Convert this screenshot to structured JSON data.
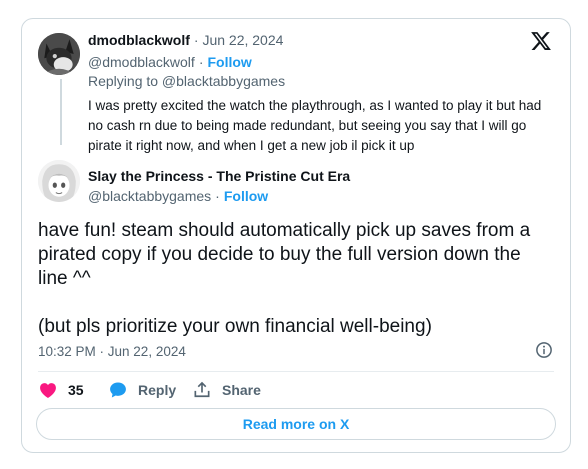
{
  "reply_tweet": {
    "display_name": "dmodblackwolf",
    "date": "· Jun 22, 2024",
    "handle": "@dmodblackwolf",
    "follow_label": "Follow",
    "dot": "·",
    "replying_to": "Replying to @blacktabbygames",
    "text": "I was pretty excited the watch the playthrough, as I wanted to play it but had no cash rn due to being made redundant, but seeing you say that I will go pirate it right now, and when I get a new job il pick it up"
  },
  "main_tweet": {
    "display_name": "Slay the Princess - The Pristine Cut Era",
    "handle": "@blacktabbygames",
    "follow_label": "Follow",
    "dot": "·",
    "text": "have fun! steam should automatically pick up saves from a pirated copy if you decide to buy the full version down the line ^^\n\n(but pls prioritize your own financial well-being)",
    "timestamp": "10:32 PM · Jun 22, 2024"
  },
  "actions": {
    "like_count": "35",
    "reply_label": "Reply",
    "share_label": "Share"
  },
  "read_more_label": "Read more on X",
  "colors": {
    "accent": "#1d9bf0",
    "like": "#f91880",
    "muted": "#536471",
    "border": "#cfd9de"
  },
  "icons": [
    "x-logo-icon",
    "info-icon",
    "heart-icon",
    "reply-bubble-icon",
    "share-icon"
  ]
}
